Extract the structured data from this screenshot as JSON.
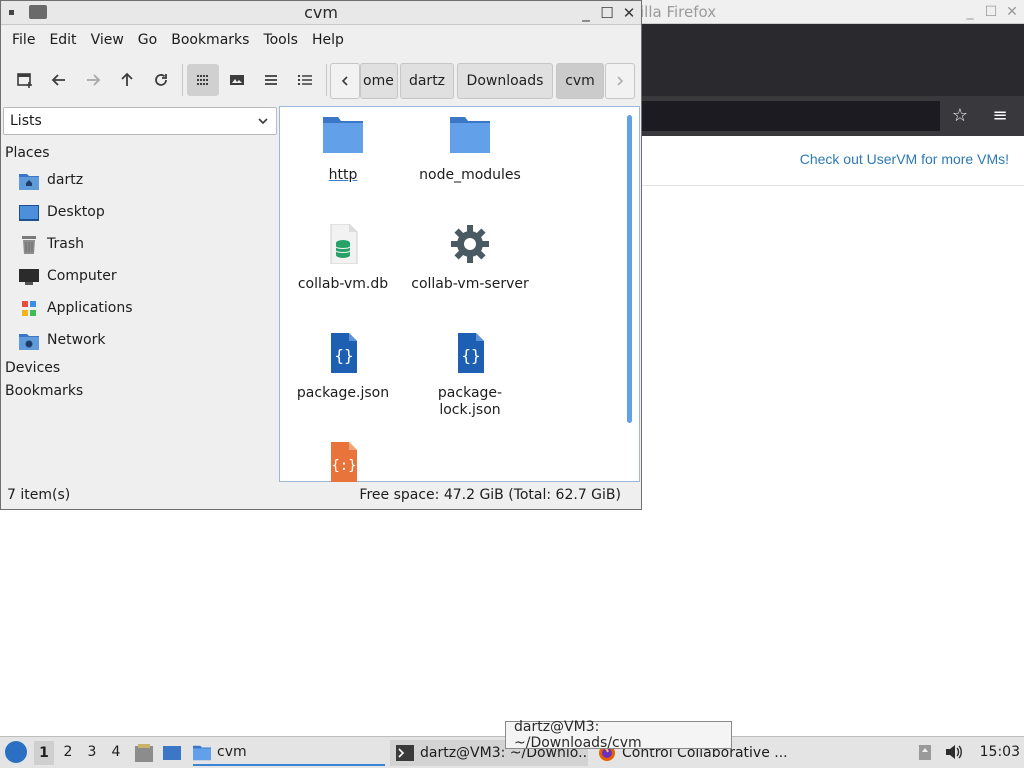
{
  "firefox": {
    "title": "illa Firefox",
    "banner_link": "Check out UserVM for more VMs!"
  },
  "file_manager": {
    "title": "cvm",
    "menu": [
      "File",
      "Edit",
      "View",
      "Go",
      "Bookmarks",
      "Tools",
      "Help"
    ],
    "breadcrumbs": [
      "ome",
      "dartz",
      "Downloads",
      "cvm"
    ],
    "side_pane": {
      "selector": "Lists",
      "places_header": "Places",
      "places": [
        {
          "label": "dartz",
          "icon": "home-folder-icon"
        },
        {
          "label": "Desktop",
          "icon": "desktop-icon"
        },
        {
          "label": "Trash",
          "icon": "trash-icon"
        },
        {
          "label": "Computer",
          "icon": "computer-icon"
        },
        {
          "label": "Applications",
          "icon": "applications-icon"
        },
        {
          "label": "Network",
          "icon": "network-icon"
        }
      ],
      "devices_header": "Devices",
      "bookmarks_header": "Bookmarks"
    },
    "files": [
      {
        "name": "http",
        "icon": "folder-icon"
      },
      {
        "name": "node_modules",
        "icon": "folder-icon"
      },
      {
        "name": "collab-vm.db",
        "icon": "database-file-icon"
      },
      {
        "name": "collab-vm-server",
        "icon": "executable-gear-icon"
      },
      {
        "name": "package.json",
        "icon": "json-file-icon"
      },
      {
        "name": "package-\nlock.json",
        "icon": "json-file-icon"
      },
      {
        "name": "",
        "icon": "script-file-icon"
      }
    ],
    "status": {
      "count": "7 item(s)",
      "free_space": "Free space: 47.2 GiB (Total: 62.7 GiB)"
    }
  },
  "taskbar": {
    "workspaces": [
      "1",
      "2",
      "3",
      "4"
    ],
    "tasks": [
      {
        "label": "cvm",
        "icon": "folder-icon"
      },
      {
        "label": "dartz@VM3: ~/Downlo...",
        "icon": "terminal-icon"
      },
      {
        "label": "Control Collaborative ...",
        "icon": "firefox-icon"
      }
    ],
    "tooltip": "dartz@VM3: ~/Downloads/cvm",
    "clock": "15:03"
  }
}
